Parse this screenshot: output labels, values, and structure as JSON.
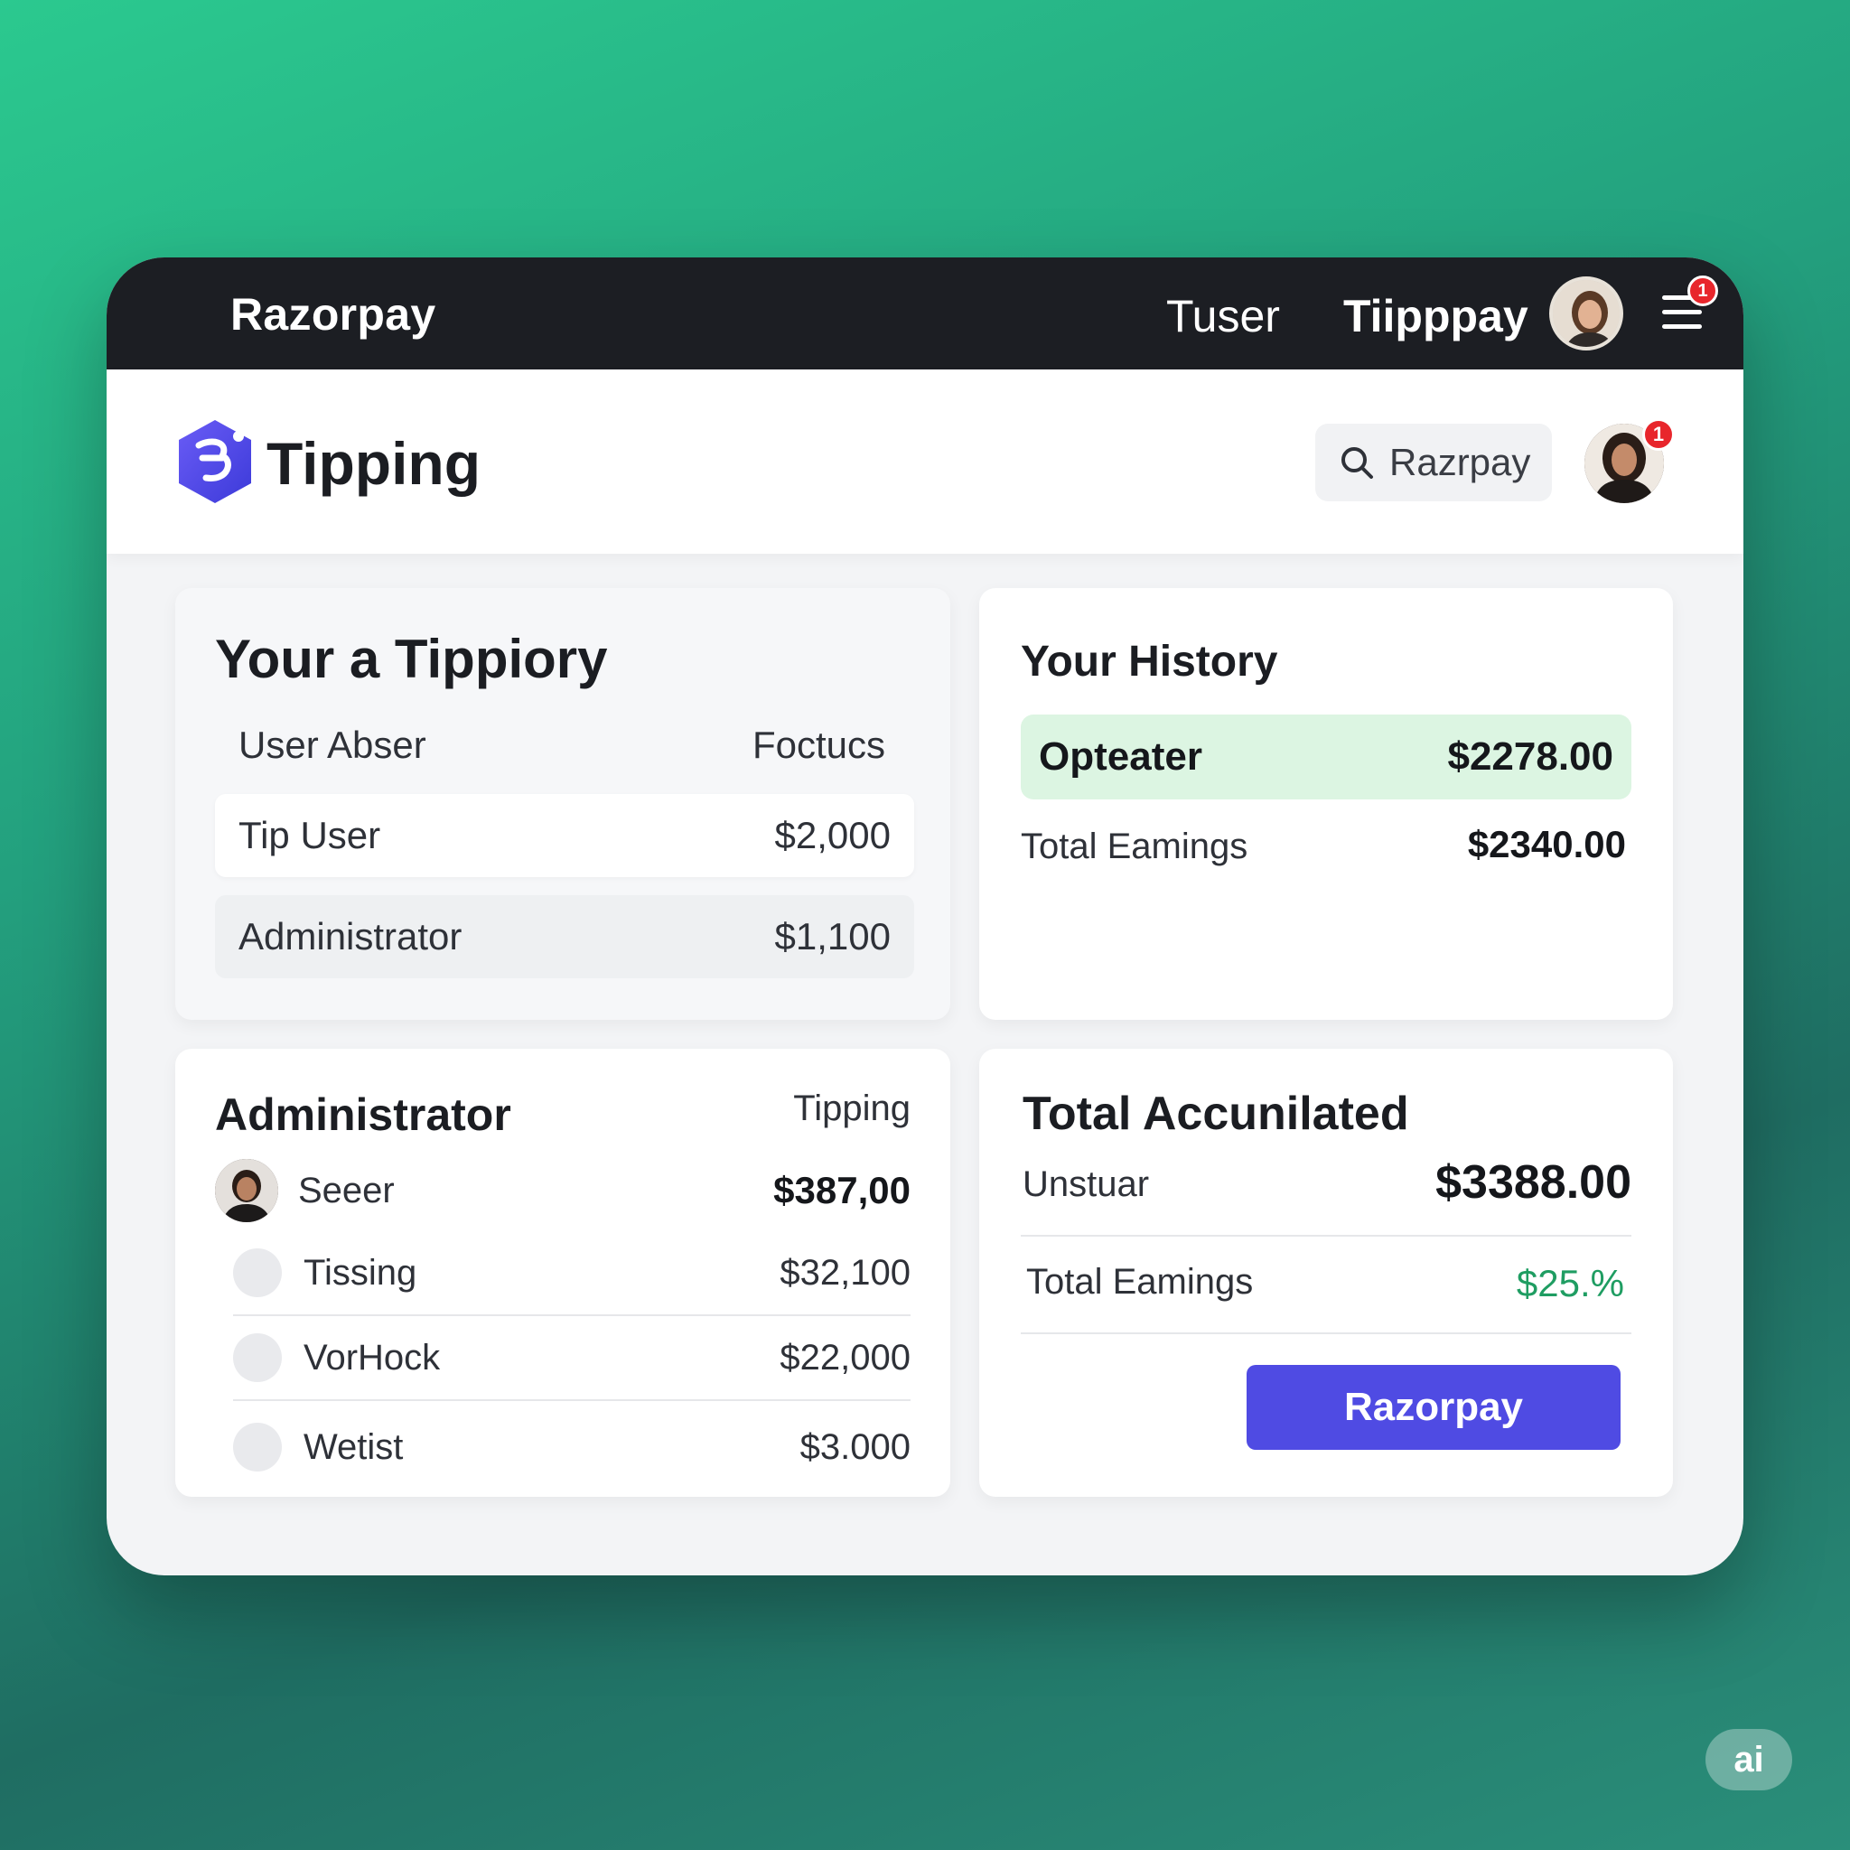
{
  "topbar": {
    "brand": "Razorpay",
    "nav": [
      "Tuser",
      "Tiipppay"
    ],
    "notification_count": "1"
  },
  "header": {
    "title": "Tipping",
    "search_value": "Razrpay",
    "notification_count": "1"
  },
  "tippiory": {
    "title": "Your a Tippiory",
    "col_left": "User Abser",
    "col_right": "Foctucs",
    "rows": [
      {
        "label": "Tip User",
        "value": "$2,000"
      },
      {
        "label": "Administrator",
        "value": "$1,100"
      }
    ]
  },
  "history": {
    "title": "Your History",
    "highlight": {
      "label": "Opteater",
      "value": "$2278.00"
    },
    "total_label": "Total Eamings",
    "total_value": "$2340.00"
  },
  "admin": {
    "title": "Administrator",
    "col_head": "Tipping",
    "rows": [
      {
        "name": "Seeer",
        "amount": "$387,00"
      },
      {
        "name": "Tissing",
        "amount": "$32,100"
      },
      {
        "name": "VorHock",
        "amount": "$22,000"
      },
      {
        "name": "Wetist",
        "amount": "$3.000"
      }
    ]
  },
  "accumulated": {
    "title": "Total Accunilated",
    "row1_label": "Unstuar",
    "row1_value": "$3388.00",
    "row2_label": "Total Eamings",
    "row2_value": "$25.%",
    "button_label": "Razorpay"
  },
  "watermark": "ai",
  "colors": {
    "accent": "#4f4be3",
    "topbar": "#1c1e23",
    "highlight": "#dcf5e2",
    "positive": "#1f9d62",
    "badge": "#e8262c"
  }
}
